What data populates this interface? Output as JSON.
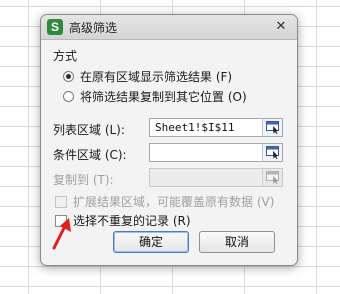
{
  "dialog": {
    "title": "高级筛选",
    "app_icon_letter": "S",
    "close_glyph": "✕"
  },
  "method": {
    "label": "方式",
    "options": [
      {
        "label": "在原有区域显示筛选结果 (F)",
        "checked": true
      },
      {
        "label": "将筛选结果复制到其它位置 (O)",
        "checked": false
      }
    ]
  },
  "fields": {
    "list_range_label": "列表区域 (L):",
    "list_range_value": "Sheet1!$I$11",
    "criteria_range_label": "条件区域 (C):",
    "criteria_range_value": "",
    "copy_to_label": "复制到 (T):",
    "copy_to_value": ""
  },
  "options": {
    "extend_label": "扩展结果区域，可能覆盖原有数据 (V)",
    "unique_label": "选择不重复的记录 (R)"
  },
  "buttons": {
    "ok": "确定",
    "cancel": "取消"
  },
  "icons": {
    "app": "wps-spreadsheet-icon",
    "range_picker": "range-select-icon",
    "annotation": "red-arrow-icon"
  },
  "colors": {
    "app_icon": "#2e8b3e",
    "arrow": "#e02020",
    "primary_border": "#4a7dc9"
  }
}
